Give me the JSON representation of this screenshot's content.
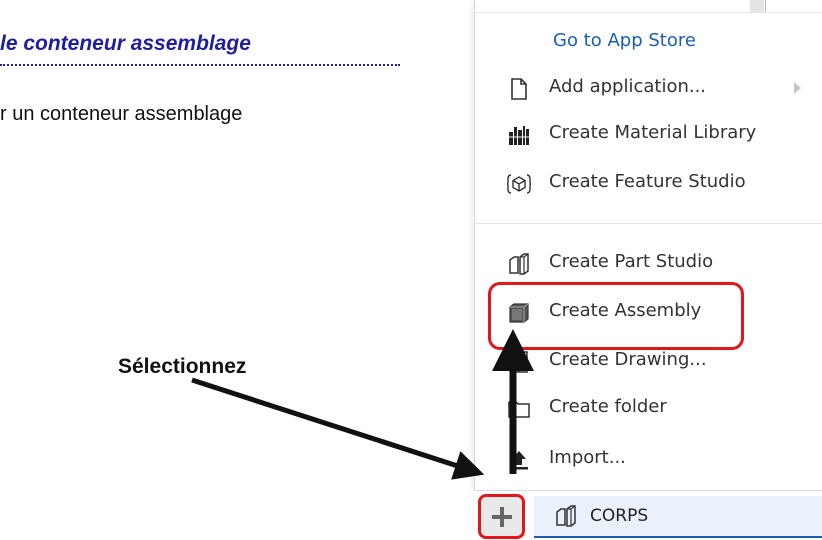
{
  "document": {
    "title": "le conteneur assemblage",
    "body_text": "r un conteneur assemblage",
    "instruction": "Sélectionnez"
  },
  "menu": {
    "app_store_label": "Go to App Store",
    "items": [
      {
        "label": "Add application...",
        "icon": "file-icon",
        "has_submenu": true
      },
      {
        "label": "Create Material Library",
        "icon": "material-library-icon"
      },
      {
        "label": "Create Feature Studio",
        "icon": "feature-studio-icon"
      },
      {
        "label": "Create Part Studio",
        "icon": "part-studio-icon"
      },
      {
        "label": "Create Assembly",
        "icon": "assembly-icon",
        "highlighted": true
      },
      {
        "label": "Create Drawing...",
        "icon": "drawing-icon"
      },
      {
        "label": "Create folder",
        "icon": "folder-icon"
      },
      {
        "label": "Import...",
        "icon": "import-icon"
      }
    ]
  },
  "tabbar": {
    "add_button_icon": "plus-icon",
    "active_tab_label": "CORPS",
    "active_tab_icon": "part-studio-icon"
  },
  "colors": {
    "link_blue": "#1b5fb3",
    "highlight_red": "#e3161b",
    "title_blue": "#1f1f9e"
  }
}
